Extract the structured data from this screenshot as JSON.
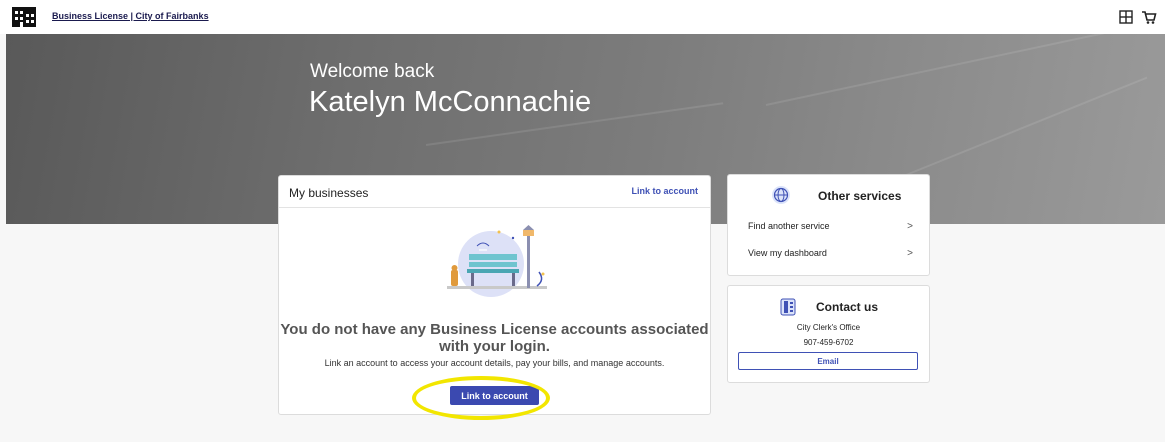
{
  "header": {
    "site_link": "Business License | City of Fairbanks",
    "logo_icon": "city-building-icon",
    "apps_icon": "grid-icon",
    "cart_icon": "cart-icon"
  },
  "hero": {
    "greeting": "Welcome back",
    "user_name": "Katelyn McConnachie"
  },
  "businesses": {
    "title": "My businesses",
    "link_label": "Link to account",
    "illustration_icon": "park-bench-illustration",
    "empty_heading": "You do not have any Business License accounts associated with your login.",
    "empty_sub": "Link an account to access your account details, pay your bills, and manage accounts.",
    "button_label": "Link to account"
  },
  "services": {
    "title": "Other services",
    "icon": "globe-icon",
    "items": [
      {
        "label": "Find another service",
        "icon": "chevron-right-icon"
      },
      {
        "label": "View my dashboard",
        "icon": "chevron-right-icon"
      }
    ]
  },
  "contact": {
    "title": "Contact us",
    "icon": "phone-icon",
    "office": "City Clerk's Office",
    "phone": "907-459-6702",
    "email_label": "Email"
  },
  "colors": {
    "accent": "#3b49b0",
    "highlight": "#f2e600",
    "hero": "#6e6e6e"
  }
}
